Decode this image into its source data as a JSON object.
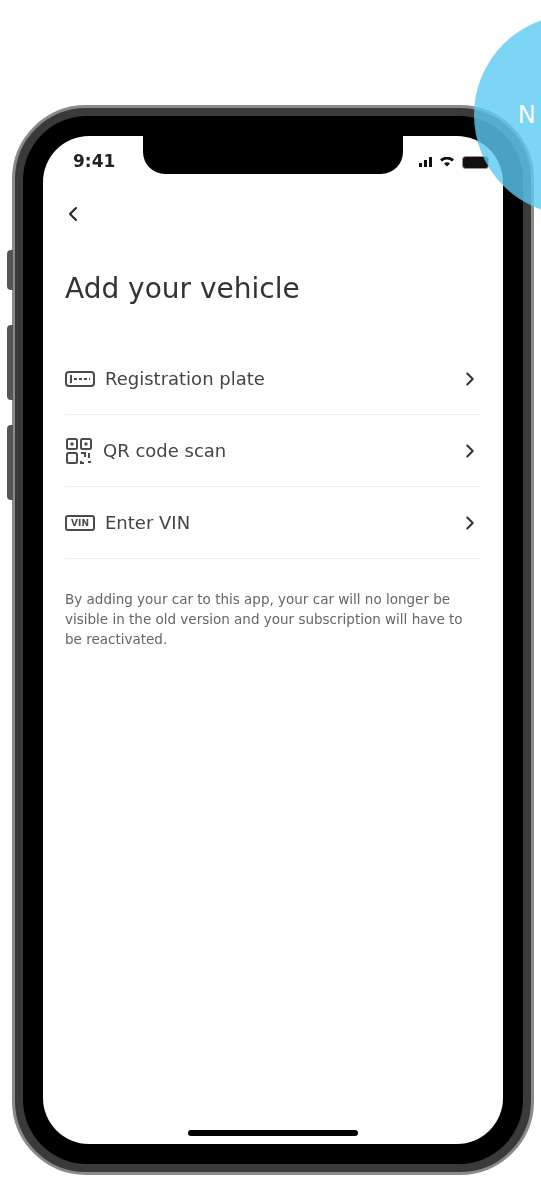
{
  "badge": {
    "text": "N"
  },
  "status_bar": {
    "time": "9:41"
  },
  "header": {
    "title": "Add your vehicle"
  },
  "options": [
    {
      "kind": "plate",
      "label": "Registration plate"
    },
    {
      "kind": "qr",
      "label": "QR code scan"
    },
    {
      "kind": "vin",
      "icon_label": "VIN",
      "label": "Enter VIN"
    }
  ],
  "note": "By adding your car to this app, your car will no longer be visible in the old version and your subscription will have to be reactivated."
}
